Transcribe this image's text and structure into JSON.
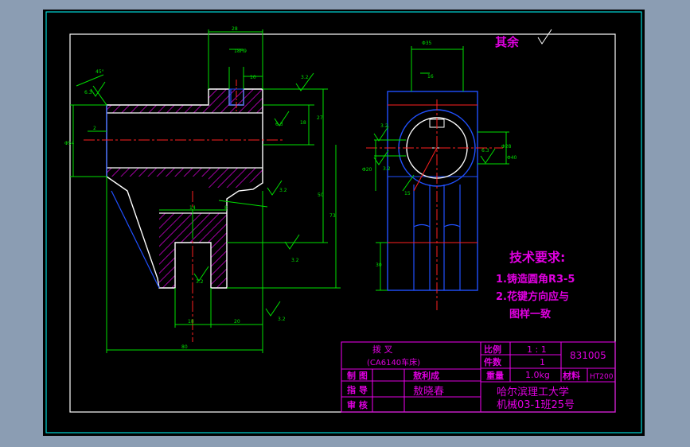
{
  "drawing": {
    "surface_note": "其余",
    "dimensions": {
      "d28": "28",
      "d18": "18",
      "d10": "10",
      "d16": "16",
      "d27": "27",
      "d50": "50",
      "d73": "73",
      "d80": "80",
      "d14": "14",
      "d20": "20",
      "d8": "8",
      "d18h": "18H9",
      "d20h": "20",
      "d32": "32",
      "d16b": "16",
      "d30": "30",
      "dia54": "Φ54",
      "dia28": "Φ28",
      "dia35": "Φ35",
      "dia20": "Φ20",
      "dia40": "Φ40",
      "d15": "15",
      "d8b": "8",
      "d45": "45°",
      "d2": "2",
      "d63": "6.3",
      "d63b": "6.3",
      "d32b": "3.2",
      "d32c": "3.2",
      "d32d": "3.2",
      "d32e": "3.2",
      "d32f": "3.2",
      "d32g": "3.2",
      "d63c": "6.3",
      "d125": "12.5",
      "d32h": "3.2"
    },
    "tech_requirements": {
      "title": "技术要求:",
      "item1": "1.铸造圆角R3-5",
      "item2": "2.花键方向应与",
      "item3": "图样一致"
    }
  },
  "title_block": {
    "part_name": "拨    叉",
    "part_sub": "(CA6140车床)",
    "scale_label": "比例",
    "scale_value": "1 : 1",
    "qty_label": "件数",
    "qty_value": "1",
    "drawing_no": "831005",
    "drawn_label": "制    图",
    "drawn_by": "敖利成",
    "weight_label": "重量",
    "weight_value": "1.0kg",
    "material_label": "材料",
    "material_value": "HT200",
    "guide_label": "指    导",
    "guide_by": "敖晓春",
    "school": "哈尔滨理工大学",
    "class": "机械03-1班25号",
    "review_label": "审    核"
  }
}
